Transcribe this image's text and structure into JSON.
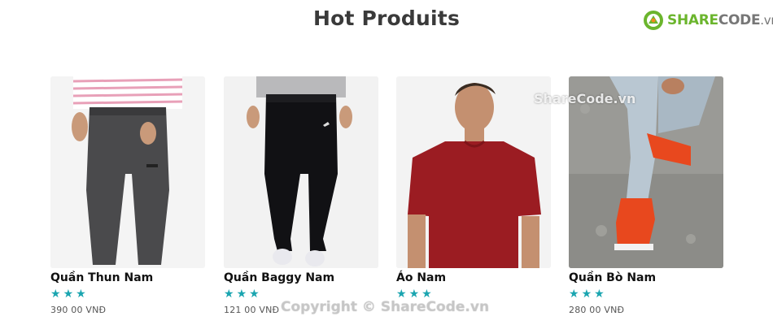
{
  "header": {
    "title": "Hot Produits"
  },
  "brand": {
    "logo_share": "SHARE",
    "logo_code": "CODE",
    "logo_vn": ".vn",
    "badge_icon": "sharecode-logo-icon",
    "color_green": "#6bb52d"
  },
  "products": [
    {
      "name": "Quần Thun Nam",
      "rating": 3,
      "price": "390 00 VNĐ",
      "image": "grey-jogger-pants-photo"
    },
    {
      "name": "Quần Baggy Nam",
      "rating": 3,
      "price": "121 00 VNĐ",
      "image": "black-baggy-pants-photo"
    },
    {
      "name": "Áo Nam",
      "rating": 3,
      "price": "",
      "image": "red-tshirt-photo"
    },
    {
      "name": "Quần Bò Nam",
      "rating": 3,
      "price": "280 00 VNĐ",
      "image": "jeans-red-sneakers-photo"
    }
  ],
  "stars": {
    "glyphs": "★ ★ ★",
    "color": "#1aa5b0"
  },
  "watermarks": {
    "center": "ShareCode.vn",
    "bottom": "Copyright © ShareCode.vn"
  }
}
